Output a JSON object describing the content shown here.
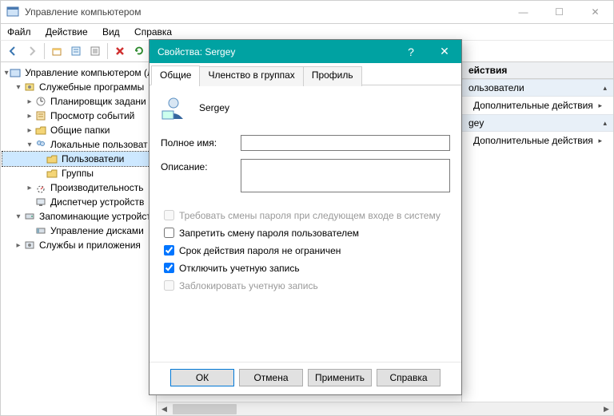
{
  "window": {
    "title": "Управление компьютером"
  },
  "menu": {
    "file": "Файл",
    "action": "Действие",
    "view": "Вид",
    "help": "Справка"
  },
  "tree": {
    "root": "Управление компьютером (л",
    "tools": "Служебные программы",
    "scheduler": "Планировщик задани",
    "events": "Просмотр событий",
    "shared": "Общие папки",
    "localusers": "Локальные пользоват",
    "users": "Пользователи",
    "groups": "Группы",
    "perf": "Производительность",
    "devmgr": "Диспетчер устройств",
    "storage": "Запоминающие устройст",
    "disks": "Управление дисками",
    "services": "Службы и приложения"
  },
  "actions": {
    "header": "ействия",
    "sec_users": "ользователи",
    "more1": "Дополнительные действия",
    "sec_user": "gey",
    "more2": "Дополнительные действия"
  },
  "dialog": {
    "title": "Свойства: Sergey",
    "tab_general": "Общие",
    "tab_member": "Членство в группах",
    "tab_profile": "Профиль",
    "username": "Sergey",
    "fullname_label": "Полное имя:",
    "fullname_value": "",
    "desc_label": "Описание:",
    "desc_value": "",
    "chk_nextlogon": "Требовать смены пароля при следующем входе в систему",
    "chk_cantchange": "Запретить смену пароля пользователем",
    "chk_neverexpire": "Срок действия пароля не ограничен",
    "chk_disable": "Отключить учетную запись",
    "chk_locked": "Заблокировать учетную запись",
    "btn_ok": "ОК",
    "btn_cancel": "Отмена",
    "btn_apply": "Применить",
    "btn_help": "Справка"
  }
}
